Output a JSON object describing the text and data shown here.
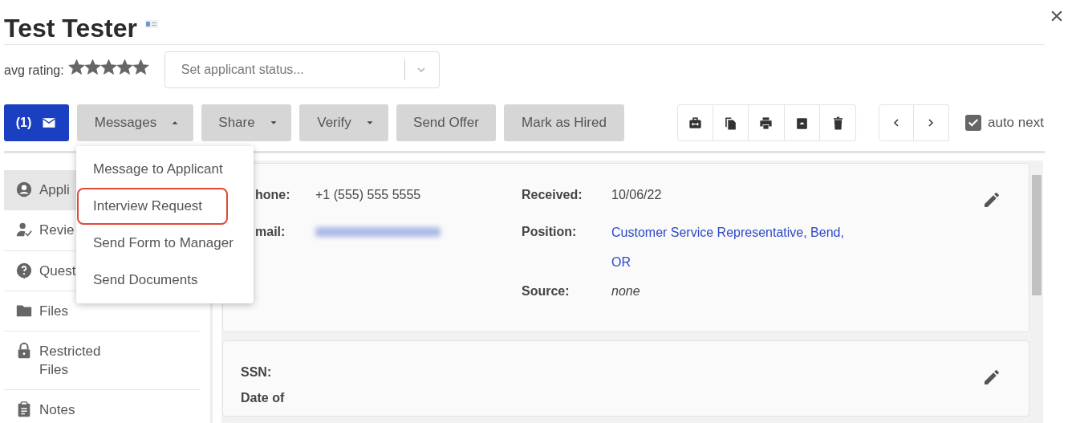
{
  "header": {
    "title": "Test Tester"
  },
  "rating": {
    "label": "avg rating:",
    "stars": 5
  },
  "status_select": {
    "placeholder": "Set applicant status..."
  },
  "toolbar": {
    "message_count": "(1)",
    "buttons": [
      {
        "label": "Messages",
        "kind": "dropdown",
        "expanded": true
      },
      {
        "label": "Share",
        "kind": "dropdown",
        "expanded": false
      },
      {
        "label": "Verify",
        "kind": "dropdown",
        "expanded": false
      },
      {
        "label": "Send Offer",
        "kind": "plain"
      },
      {
        "label": "Mark as Hired",
        "kind": "plain"
      }
    ],
    "auto_next": {
      "label": "auto next",
      "checked": true
    }
  },
  "messages_menu": {
    "items": [
      {
        "label": "Message to Applicant",
        "highlighted": false
      },
      {
        "label": "Interview Request",
        "highlighted": true
      },
      {
        "label": "Send Form to Manager",
        "highlighted": false
      },
      {
        "label": "Send Documents",
        "highlighted": false
      }
    ]
  },
  "sidebar": {
    "items": [
      {
        "label": "Appli",
        "selected": true
      },
      {
        "label": "Revie",
        "selected": false
      },
      {
        "label": "Quest",
        "selected": false
      },
      {
        "label": "Files",
        "selected": false
      },
      {
        "label": "Restricted Files",
        "selected": false
      },
      {
        "label": "Notes",
        "selected": false
      }
    ]
  },
  "details": {
    "cards": [
      {
        "left": [
          {
            "label": "hone:",
            "value": "+1 (555) 555 5555"
          },
          {
            "label": "mail:",
            "kind": "redacted"
          }
        ],
        "right": [
          {
            "label": "Received:",
            "value": "10/06/22",
            "kind": "text"
          },
          {
            "label": "Position:",
            "value": "Customer Service Representative, Bend, OR",
            "kind": "link"
          },
          {
            "label": "Source:",
            "value": "none",
            "kind": "italic"
          }
        ]
      },
      {
        "left": [
          {
            "label": "SSN:"
          },
          {
            "label": "Date of"
          }
        ]
      }
    ]
  }
}
